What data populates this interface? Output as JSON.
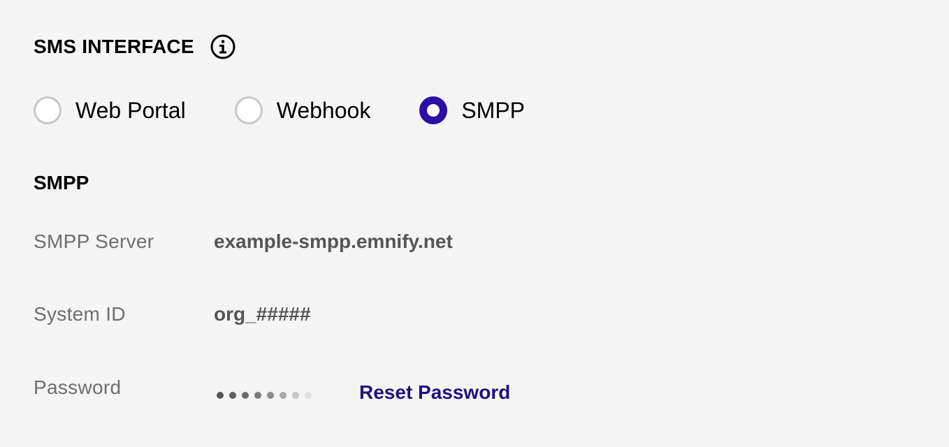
{
  "section": {
    "title": "SMS INTERFACE",
    "info_icon": "info-circle-icon"
  },
  "interface_options": [
    {
      "label": "Web Portal",
      "checked": false
    },
    {
      "label": "Webhook",
      "checked": false
    },
    {
      "label": "SMPP",
      "checked": true
    }
  ],
  "smpp": {
    "title": "SMPP",
    "server_label": "SMPP Server",
    "server_value": "example-smpp.emnify.net",
    "system_id_label": "System ID",
    "system_id_value": "org_#####",
    "password_label": "Password",
    "reset_password_label": "Reset Password"
  },
  "colors": {
    "accent": "#2b0fa6",
    "link": "#230f80",
    "label_gray": "#6e6e6e",
    "value_gray": "#555555"
  }
}
